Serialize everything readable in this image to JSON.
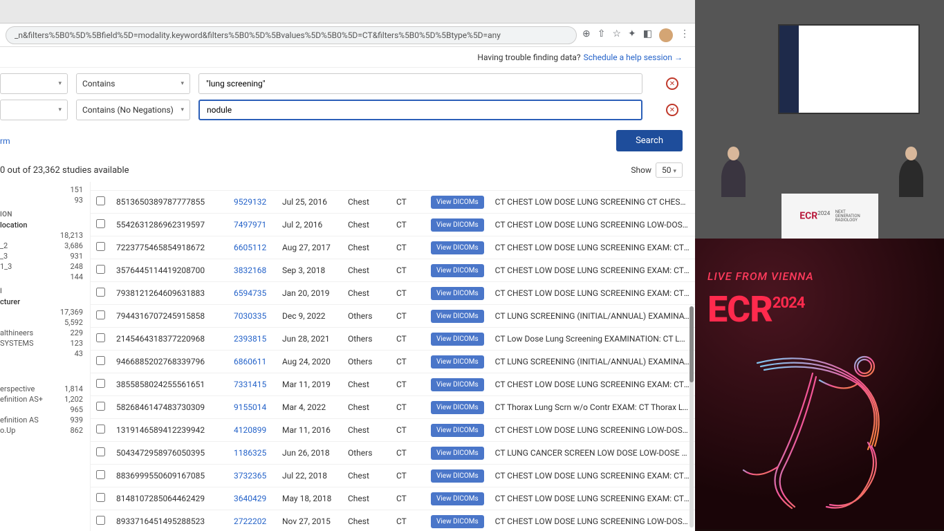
{
  "browser": {
    "url": "_n&filters%5B0%5D%5Bfield%5D=modality.keyword&filters%5B0%5D%5Bvalues%5D%5B0%5D=CT&filters%5B0%5D%5Btype%5D=any"
  },
  "help_bar": {
    "prompt": "Having trouble finding data?",
    "link_text": "Schedule a help session →"
  },
  "filters": {
    "row1_op": "Contains",
    "row1_value": "\"lung screening\"",
    "row2_op": "Contains (No Negations)",
    "row2_value": "nodule",
    "add_term": "rm",
    "search_label": "Search"
  },
  "count": {
    "text": "0 out of 23,362 studies available",
    "show_label": "Show",
    "show_value": "50"
  },
  "facets": {
    "group1": [
      {
        "label": "",
        "count": "151"
      },
      {
        "label": "",
        "count": "93"
      }
    ],
    "head_ion": "ION",
    "head_location": "location",
    "loc": [
      {
        "label": "",
        "count": "18,213"
      },
      {
        "label": "_2",
        "count": "3,686"
      },
      {
        "label": "_3",
        "count": "931"
      },
      {
        "label": "1_3",
        "count": "248"
      },
      {
        "label": "",
        "count": "144"
      }
    ],
    "head_i": "i",
    "head_cturer": "cturer",
    "mfr": [
      {
        "label": "",
        "count": "17,369"
      },
      {
        "label": "",
        "count": "5,592"
      },
      {
        "label": "althineers",
        "count": "229"
      },
      {
        "label": "SYSTEMS",
        "count": "123"
      },
      {
        "label": "",
        "count": "43"
      }
    ],
    "model": [
      {
        "label": "erspective",
        "count": "1,814"
      },
      {
        "label": "efinition AS+",
        "count": "1,202"
      },
      {
        "label": "",
        "count": "965"
      },
      {
        "label": "efinition AS",
        "count": "939"
      },
      {
        "label": "o.Up",
        "count": "862"
      }
    ]
  },
  "rows": [
    {
      "study": "8513650389787777855",
      "patient": "9529132",
      "date": "Jul 25, 2016",
      "body": "Chest",
      "mod": "CT",
      "desc": "CT CHEST LOW DOSE LUNG SCREENING CT CHEST, LOW-DC"
    },
    {
      "study": "5542631286962319597",
      "patient": "7497971",
      "date": "Jul 2, 2016",
      "body": "Chest",
      "mod": "CT",
      "desc": "CT CHEST LOW DOSE LUNG SCREENING LOW-DOSE CHEST C"
    },
    {
      "study": "7223775465854918672",
      "patient": "6605112",
      "date": "Aug 27, 2017",
      "body": "Chest",
      "mod": "CT",
      "desc": "CT CHEST LOW DOSE LUNG SCREENING EXAM: CT CHEST LO"
    },
    {
      "study": "3576445114419208700",
      "patient": "3832168",
      "date": "Sep 3, 2018",
      "body": "Chest",
      "mod": "CT",
      "desc": "CT CHEST LOW DOSE LUNG SCREENING EXAM: CT CHEST LO"
    },
    {
      "study": "7938121264609631883",
      "patient": "6594735",
      "date": "Jan 20, 2019",
      "body": "Chest",
      "mod": "CT",
      "desc": "CT CHEST LOW DOSE LUNG SCREENING EXAM: CT CHEST LO"
    },
    {
      "study": "7944316707245915858",
      "patient": "7030335",
      "date": "Dec 9, 2022",
      "body": "Others",
      "mod": "CT",
      "desc": "CT LUNG SCREENING (INITIAL/ANNUAL) EXAMINATION: CT L"
    },
    {
      "study": "2145464318377220968",
      "patient": "2393815",
      "date": "Jun 28, 2021",
      "body": "Others",
      "mod": "CT",
      "desc": "CT Low Dose Lung Screening EXAMINATION: CT Low Dose Lu"
    },
    {
      "study": "9466885202768339796",
      "patient": "6860611",
      "date": "Aug 24, 2020",
      "body": "Others",
      "mod": "CT",
      "desc": "CT LUNG SCREENING (INITIAL/ANNUAL) EXAMINATION: CT L"
    },
    {
      "study": "3855858024255561651",
      "patient": "7331415",
      "date": "Mar 11, 2019",
      "body": "Chest",
      "mod": "CT",
      "desc": "CT CHEST LOW DOSE LUNG SCREENING EXAM: CT CHEST LO"
    },
    {
      "study": "5826846147483730309",
      "patient": "9155014",
      "date": "Mar 4, 2022",
      "body": "Chest",
      "mod": "CT",
      "desc": "CT Thorax Lung Scrn w/o Contr EXAM: CT Thorax Lung Scrn "
    },
    {
      "study": "1319146589412239942",
      "patient": "4120899",
      "date": "Mar 11, 2016",
      "body": "Chest",
      "mod": "CT",
      "desc": "CT CHEST LOW DOSE LUNG SCREENING LOW-DOSE LUNG S"
    },
    {
      "study": "5043472958976050395",
      "patient": "1186325",
      "date": "Jun 26, 2018",
      "body": "Others",
      "mod": "CT",
      "desc": "CT LUNG CANCER SCREEN LOW DOSE LOW-DOSE LUNG SC"
    },
    {
      "study": "8836999550609167085",
      "patient": "3732365",
      "date": "Jul 22, 2018",
      "body": "Chest",
      "mod": "CT",
      "desc": "CT CHEST LOW DOSE LUNG SCREENING EXAM: CT CHEST LO"
    },
    {
      "study": "8148107285064462429",
      "patient": "3640429",
      "date": "May 18, 2018",
      "body": "Chest",
      "mod": "CT",
      "desc": "CT CHEST LOW DOSE LUNG SCREENING EXAM: CT CHEST LO"
    },
    {
      "study": "8933716451495288523",
      "patient": "2722202",
      "date": "Nov 27, 2015",
      "body": "Chest",
      "mod": "CT",
      "desc": "CT CHEST LOW DOSE LUNG SCREENING LOW-DOSE LUNG S"
    }
  ],
  "view_btn_label": "View DICOMs",
  "right": {
    "podium_logo": "ECR",
    "podium_year": "2024",
    "podium_tag1": "NEXT",
    "podium_tag2": "GENERATION",
    "podium_tag3": "RADIOLOGY",
    "live_from": "LIVE FROM VIENNA",
    "big_logo": "ECR",
    "big_year": "2024"
  }
}
